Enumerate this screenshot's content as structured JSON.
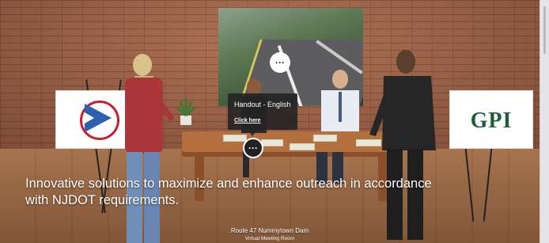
{
  "scene": {
    "tagline": "Innovative solutions to maximize and enhance outreach in accordance with NJDOT requirements.",
    "room_title": "Route 47 Nummytown Dam",
    "room_subtitle": "Virtual Meeting Room"
  },
  "posters": {
    "right_logo_text": "GPI",
    "left_logo_icon": "njdot-arrow-logo"
  },
  "hotspots": [
    {
      "icon": "chat-icon",
      "glyph": "···"
    },
    {
      "icon": "chat-icon",
      "glyph": "···"
    }
  ],
  "popup": {
    "title": "Handout - English",
    "link": "Click here"
  },
  "colors": {
    "accent": "#1d5f3b",
    "logo_red": "#c8202f",
    "logo_blue": "#2e5fb1"
  }
}
